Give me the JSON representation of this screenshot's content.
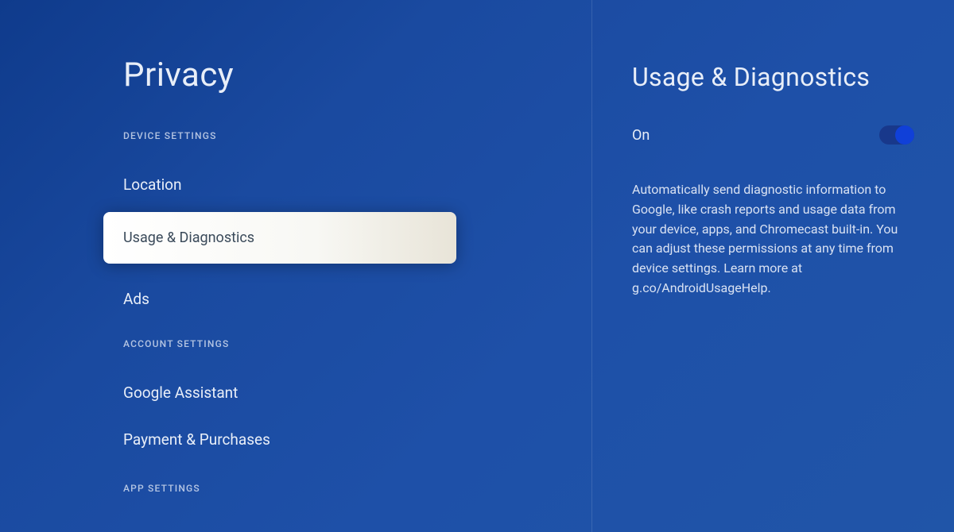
{
  "leftPanel": {
    "title": "Privacy",
    "sections": {
      "device": {
        "header": "DEVICE SETTINGS",
        "items": {
          "location": "Location",
          "usageDiagnostics": "Usage & Diagnostics",
          "ads": "Ads"
        }
      },
      "account": {
        "header": "ACCOUNT SETTINGS",
        "items": {
          "googleAssistant": "Google Assistant",
          "paymentPurchases": "Payment & Purchases"
        }
      },
      "app": {
        "header": "APP SETTINGS"
      }
    }
  },
  "rightPanel": {
    "title": "Usage & Diagnostics",
    "toggleLabel": "On",
    "description": "Automatically send diagnostic information to Google, like crash reports and usage data from your device, apps, and Chromecast built-in. You can adjust these permissions at any time from device settings. Learn more at g.co/AndroidUsageHelp."
  }
}
